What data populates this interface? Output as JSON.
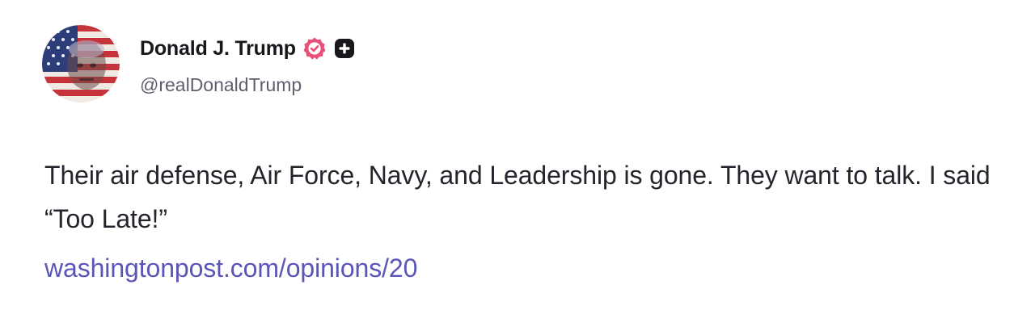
{
  "author": {
    "display_name": "Donald J. Trump",
    "handle": "@realDonaldTrump",
    "avatar_icon": "avatar-flag-portrait",
    "verified_icon": "verified-check-icon",
    "verified_color": "#e8507a",
    "badge_icon": "plus-badge-icon"
  },
  "post": {
    "text": "Their air defense, Air Force, Navy, and Leadership is gone. They want to talk. I said “Too Late!”",
    "link_text": "washingtonpost.com/opinions/20",
    "link_color": "#5b55b8"
  }
}
